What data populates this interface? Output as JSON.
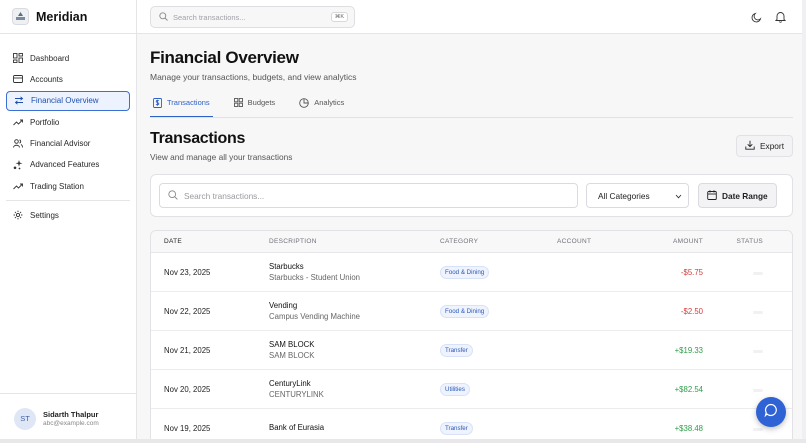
{
  "app": {
    "name": "Meridian"
  },
  "sidebar": {
    "items": [
      {
        "label": "Dashboard",
        "icon": "dashboard-icon"
      },
      {
        "label": "Accounts",
        "icon": "credit-card-icon"
      },
      {
        "label": "Financial Overview",
        "icon": "arrows-swap-icon",
        "active": true
      },
      {
        "label": "Portfolio",
        "icon": "trending-up-icon"
      },
      {
        "label": "Financial Advisor",
        "icon": "users-icon"
      },
      {
        "label": "Advanced Features",
        "icon": "sparkles-icon"
      },
      {
        "label": "Trading Station",
        "icon": "trending-up-icon"
      }
    ],
    "settings_label": "Settings",
    "user": {
      "initials": "ST",
      "name": "Sidarth Thalpur",
      "email": "abc@example.com"
    }
  },
  "topbar": {
    "search_placeholder": "Search transactions...",
    "shortcut": "⌘K"
  },
  "page": {
    "title": "Financial Overview",
    "subtitle": "Manage your transactions, budgets, and view analytics"
  },
  "tabs": [
    {
      "label": "Transactions",
      "icon": "dollar-doc-icon",
      "active": true
    },
    {
      "label": "Budgets",
      "icon": "grid-icon"
    },
    {
      "label": "Analytics",
      "icon": "pie-chart-icon"
    }
  ],
  "section": {
    "title": "Transactions",
    "subtitle": "View and manage all your transactions",
    "export_label": "Export"
  },
  "filters": {
    "search_placeholder": "Search transactions...",
    "category_value": "All Categories",
    "date_range_label": "Date Range"
  },
  "table": {
    "headers": [
      "DATE",
      "DESCRIPTION",
      "CATEGORY",
      "ACCOUNT",
      "AMOUNT",
      "STATUS"
    ],
    "rows": [
      {
        "date": "Nov 23, 2025",
        "title": "Starbucks",
        "detail": "Starbucks - Student Union",
        "category": "Food & Dining",
        "account": "",
        "amount": "-$5.75",
        "sign": "neg"
      },
      {
        "date": "Nov 22, 2025",
        "title": "Vending",
        "detail": "Campus Vending Machine",
        "category": "Food & Dining",
        "account": "",
        "amount": "-$2.50",
        "sign": "neg"
      },
      {
        "date": "Nov 21, 2025",
        "title": "SAM BLOCK",
        "detail": "SAM BLOCK",
        "category": "Transfer",
        "account": "",
        "amount": "+$19.33",
        "sign": "pos"
      },
      {
        "date": "Nov 20, 2025",
        "title": "CenturyLink",
        "detail": "CENTURYLINK",
        "category": "Utilities",
        "account": "",
        "amount": "+$82.54",
        "sign": "pos"
      },
      {
        "date": "Nov 19, 2025",
        "title": "Bank of Eurasia",
        "detail": "",
        "category": "Transfer",
        "account": "",
        "amount": "+$38.48",
        "sign": "pos"
      }
    ]
  },
  "colors": {
    "accent": "#2f62c7",
    "negative": "#d63a3a",
    "positive": "#2f9e4a",
    "fab": "#2f62d4"
  }
}
